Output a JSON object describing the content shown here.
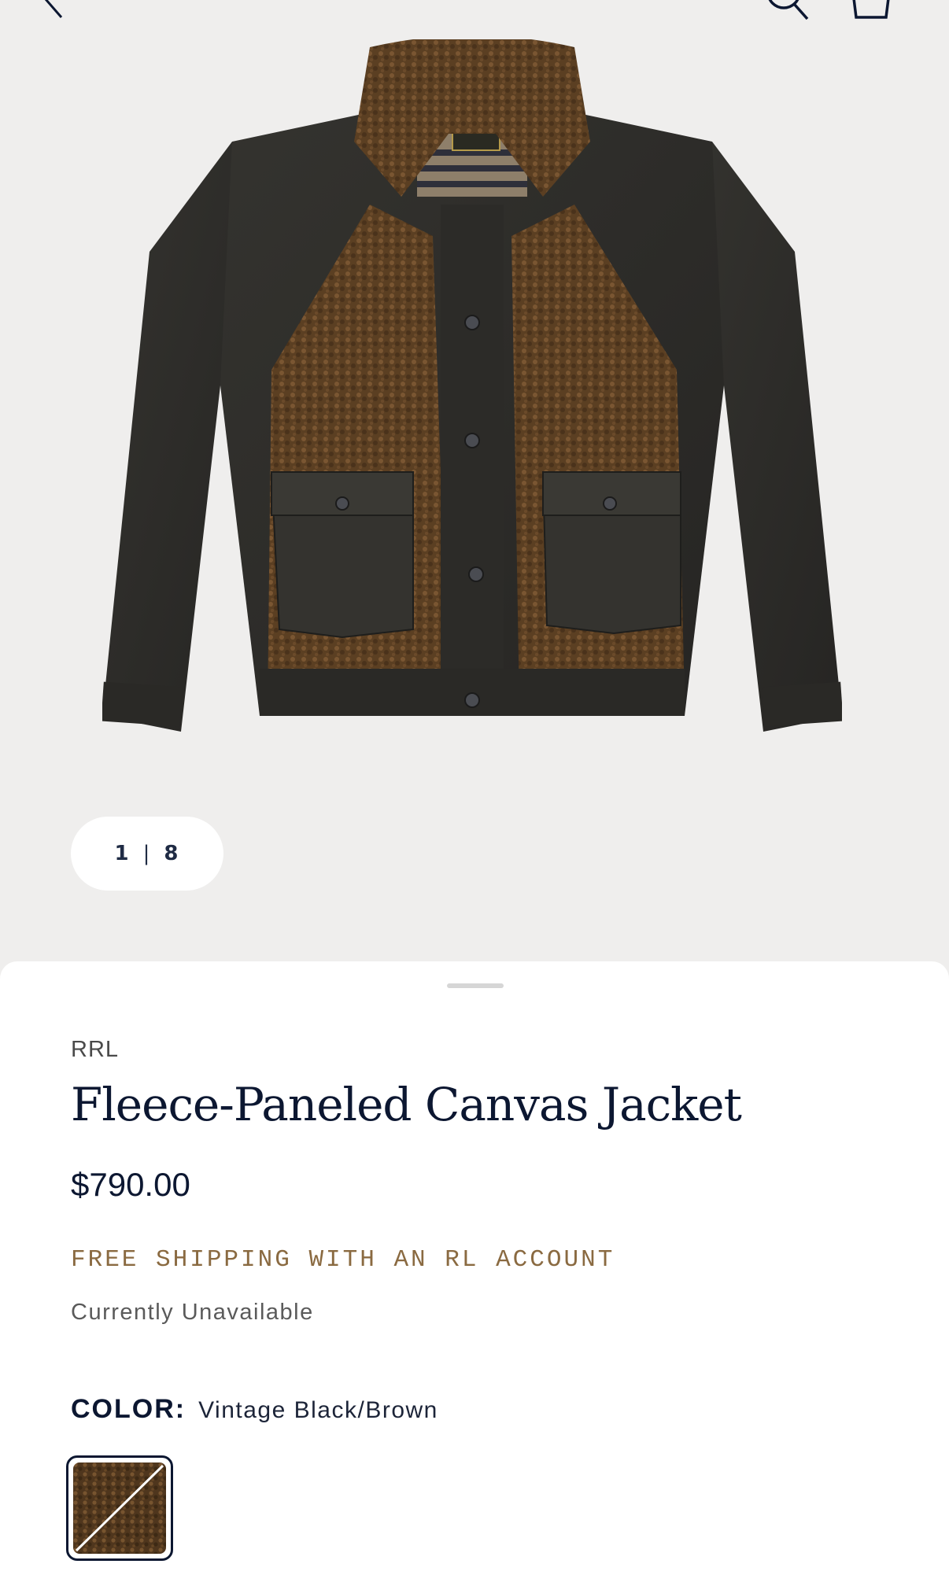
{
  "gallery": {
    "current": "1",
    "total": "8",
    "separator": "|"
  },
  "product": {
    "brand": "RRL",
    "name": "Fleece-Paneled Canvas Jacket",
    "price": "$790.00",
    "shipping_promo": "FREE SHIPPING WITH AN RL ACCOUNT",
    "availability": "Currently Unavailable",
    "color_label": "COLOR:",
    "color_value": "Vintage Black/Brown"
  },
  "icons": {
    "back": "chevron-left-icon",
    "search": "search-icon",
    "bag": "shopping-bag-icon"
  },
  "colors": {
    "navy": "#0c1731",
    "gold_promo": "#8a6a41",
    "canvas_black": "#2b2b29",
    "fleece_brown": "#5a3e22",
    "background": "#efeeed"
  }
}
